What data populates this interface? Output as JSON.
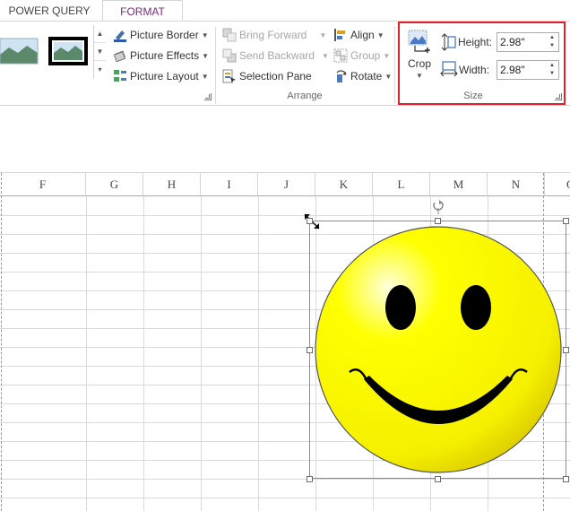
{
  "tabs": {
    "power_query": "POWER QUERY",
    "format": "FORMAT"
  },
  "picture_styles": {
    "picture_border": "Picture Border",
    "picture_effects": "Picture Effects",
    "picture_layout": "Picture Layout"
  },
  "arrange": {
    "bring_forward": "Bring Forward",
    "send_backward": "Send Backward",
    "selection_pane": "Selection Pane",
    "align": "Align",
    "group": "Group",
    "rotate": "Rotate",
    "group_label": "Arrange"
  },
  "size": {
    "crop": "Crop",
    "height_label": "Height:",
    "height_value": "2.98\"",
    "width_label": "Width:",
    "width_value": "2.98\"",
    "group_label": "Size"
  },
  "sheet": {
    "columns": [
      "F",
      "G",
      "H",
      "I",
      "J",
      "K",
      "L",
      "M",
      "N",
      "O"
    ]
  },
  "colors": {
    "format_tab": "#7a2a7a",
    "highlight_box": "#e0202a",
    "smiley_yellow": "#ffff00",
    "smiley_dark": "#000000"
  },
  "icons": [
    "picture-border-icon",
    "picture-effects-icon",
    "picture-layout-icon",
    "bring-forward-icon",
    "send-backward-icon",
    "selection-pane-icon",
    "align-icon",
    "group-icon",
    "rotate-icon",
    "crop-icon",
    "height-icon",
    "width-icon",
    "rotate-handle-icon"
  ]
}
